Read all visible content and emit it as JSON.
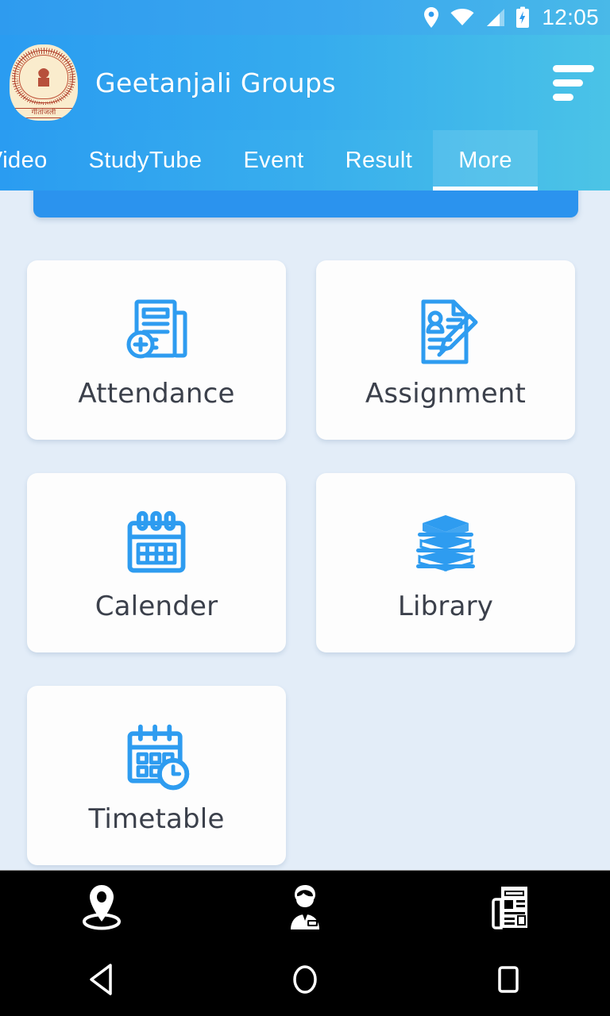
{
  "status_bar": {
    "time": "12:05",
    "icons": [
      "location-pin-icon",
      "wifi-icon",
      "cellular-signal-icon",
      "battery-charging-icon"
    ]
  },
  "app_bar": {
    "title": "Geetanjali Groups",
    "logo_caption": "गीतांजली",
    "logo_name": "geetanjali-logo",
    "menu_icon": "hamburger-menu-icon"
  },
  "tabs": [
    {
      "label": "Video",
      "active": false
    },
    {
      "label": "StudyTube",
      "active": false
    },
    {
      "label": "Event",
      "active": false
    },
    {
      "label": "Result",
      "active": false
    },
    {
      "label": "More",
      "active": true
    }
  ],
  "menu_grid": [
    {
      "label": "Attendance",
      "icon": "attendance-document-icon"
    },
    {
      "label": "Assignment",
      "icon": "assignment-pencil-icon"
    },
    {
      "label": "Calender",
      "icon": "calendar-icon"
    },
    {
      "label": "Library",
      "icon": "books-stack-icon"
    },
    {
      "label": "Timetable",
      "icon": "timetable-clock-icon"
    }
  ],
  "bottom_nav": [
    {
      "icon": "location-pin-icon"
    },
    {
      "icon": "teacher-person-icon"
    },
    {
      "icon": "newspaper-icon"
    }
  ],
  "system_nav": [
    {
      "icon": "back-triangle-icon"
    },
    {
      "icon": "home-circle-icon"
    },
    {
      "icon": "recents-square-icon"
    }
  ],
  "colors": {
    "header_start": "#2a9cf1",
    "header_end": "#4cc4e6",
    "background": "#e3edf8",
    "card": "#fdfdfd",
    "icon_blue": "#2e9cf0",
    "label_text": "#3b404b",
    "banner": "#2b93ee"
  }
}
